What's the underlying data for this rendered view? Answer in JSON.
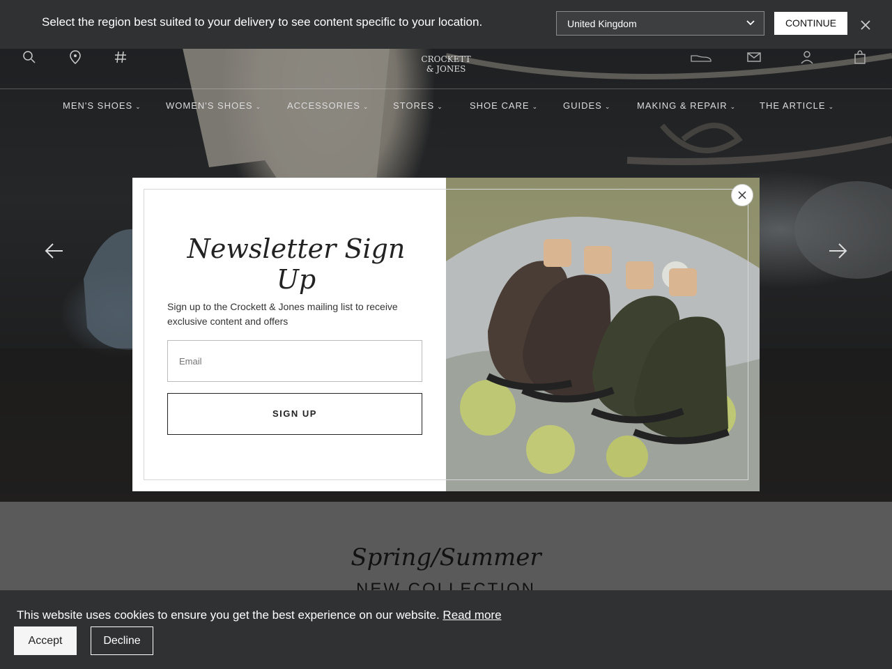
{
  "region_bar": {
    "message": "Select the region best suited to your delivery to see content specific to your location.",
    "selected_region": "United Kingdom",
    "continue_label": "CONTINUE"
  },
  "header": {
    "logo_line1": "CROCKETT",
    "logo_line2": "& JONES",
    "left_icons": [
      "search-icon",
      "location-pin-icon",
      "hashtag-icon"
    ],
    "right_icons": [
      "shoe-icon",
      "mail-icon",
      "user-icon",
      "shopping-bag-icon"
    ]
  },
  "nav": {
    "items": [
      {
        "label": "MEN'S SHOES"
      },
      {
        "label": "WOMEN'S SHOES"
      },
      {
        "label": "ACCESSORIES"
      },
      {
        "label": "STORES"
      },
      {
        "label": "SHOE CARE"
      },
      {
        "label": "GUIDES"
      },
      {
        "label": "MAKING & REPAIR"
      },
      {
        "label": "THE ARTICLE"
      }
    ]
  },
  "hero": {
    "prev_icon": "arrow-left-icon",
    "next_icon": "arrow-right-icon"
  },
  "collection": {
    "script_title": "Spring/Summer",
    "subtitle": "NEW COLLECTION"
  },
  "newsletter": {
    "title": "Newsletter Sign Up",
    "description": "Sign up to the Crockett & Jones mailing list to receive exclusive content and offers",
    "email_placeholder": "Email",
    "signup_label": "SIGN UP"
  },
  "cookie": {
    "message": "This website uses cookies to ensure you get the best experience on our website.",
    "read_more": "Read more",
    "accept_label": "Accept",
    "decline_label": "Decline"
  },
  "colors": {
    "bar_bg": "#2f3133",
    "modal_bg": "#ffffff",
    "nav_text": "#dddddd"
  }
}
